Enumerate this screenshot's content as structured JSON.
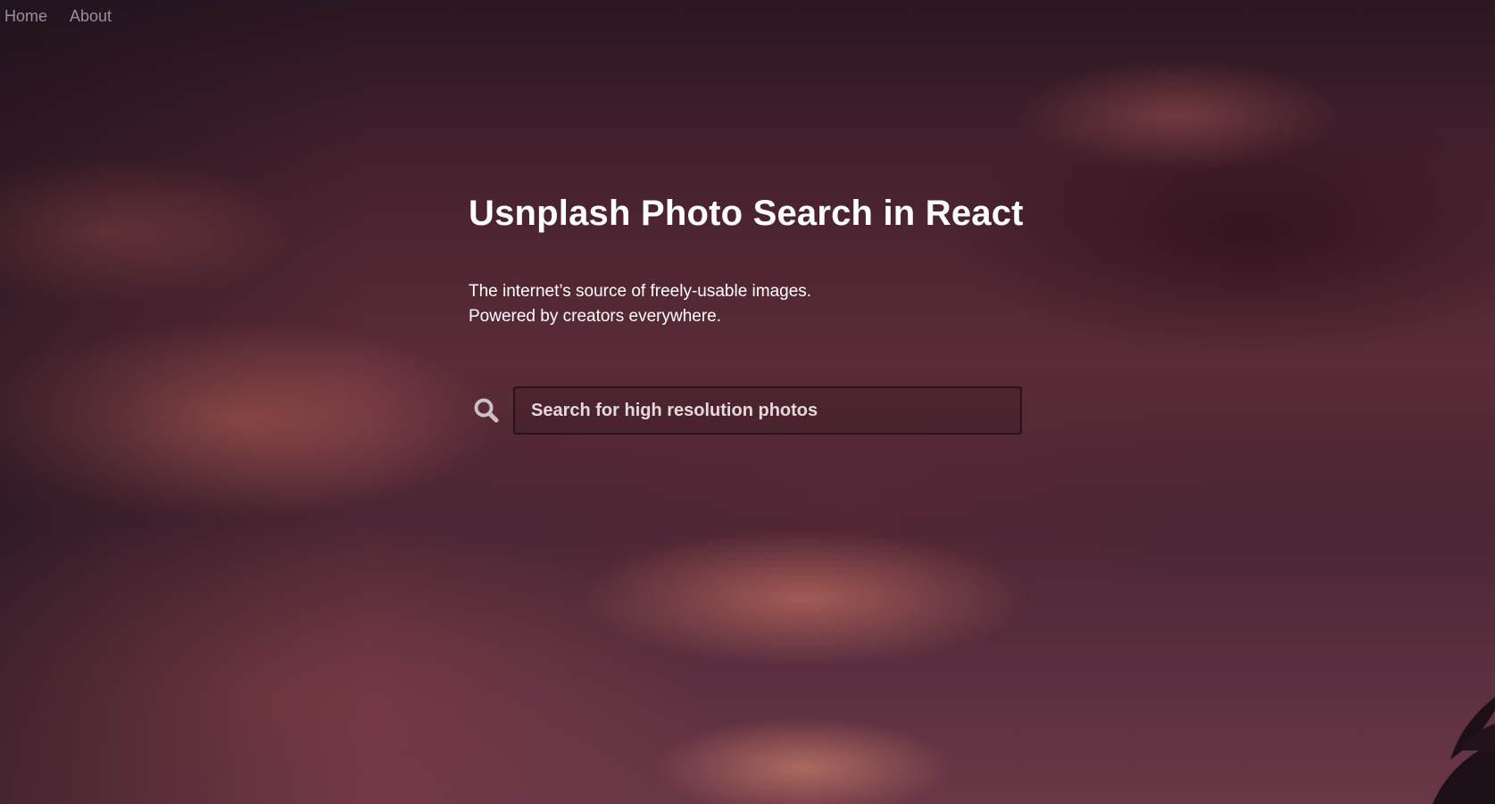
{
  "nav": {
    "items": [
      {
        "label": "Home"
      },
      {
        "label": "About"
      }
    ]
  },
  "hero": {
    "title": "Usnplash Photo Search in React",
    "subtitle_line1": "The internet’s source of freely-usable images.",
    "subtitle_line2": "Powered by creators everywhere."
  },
  "search": {
    "placeholder": "Search for high resolution photos",
    "icon": "search-icon"
  },
  "colors": {
    "nav_text": "#9a8f98",
    "title_text": "#ffffff",
    "search_icon": "#cdbdc4"
  }
}
